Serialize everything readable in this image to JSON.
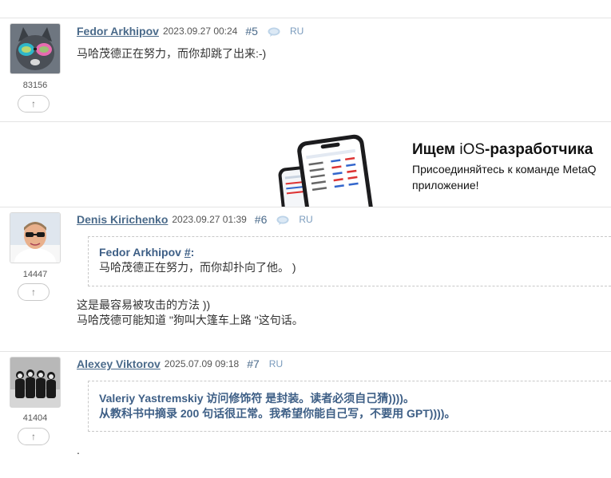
{
  "posts": [
    {
      "author": "Fedor Arkhipov",
      "date": "2023.09.27 00:24",
      "number": "#5",
      "lang": "RU",
      "rating": "83156",
      "vote_icon": "arrow-up-icon",
      "body": [
        "马哈茂德正在努力，而你却跳了出来:-)"
      ]
    },
    {
      "author": "Denis Kirichenko",
      "date": "2023.09.27 01:39",
      "number": "#6",
      "lang": "RU",
      "rating": "14447",
      "vote_icon": "arrow-up-icon",
      "quote": {
        "author": "Fedor Arkhipov",
        "link": "#",
        "suffix": ":",
        "text": "马哈茂德正在努力，而你却扑向了他。 )"
      },
      "body": [
        "这是最容易被攻击的方法 ))",
        "马哈茂德可能知道 \"狗叫大篷车上路 \"这句话。"
      ]
    },
    {
      "author": "Alexey Viktorov",
      "date": "2025.07.09 09:18",
      "number": "#7",
      "lang": "RU",
      "rating": "41404",
      "vote_icon": "arrow-up-icon",
      "quote": {
        "lines": [
          "Valeriy Yastremskiy 访问修饰符 是封装。读者必须自己猜))))。",
          "从教科书中摘录 200 句话很正常。我希望你能自己写，不要用 GPT))))。"
        ]
      },
      "body": [
        "."
      ]
    }
  ],
  "ad": {
    "title_bold_1": "Ищем ",
    "title_light": "iOS",
    "title_bold_2": "-разработчика",
    "desc_line1": "Присоединяйтесь к команде MetaQ",
    "desc_line2": "приложение!"
  },
  "colors": {
    "link": "#4a6a8a",
    "quote_bold": "#3e5f86",
    "lang": "#7a9bbd",
    "divider": "#e4e4e4"
  }
}
